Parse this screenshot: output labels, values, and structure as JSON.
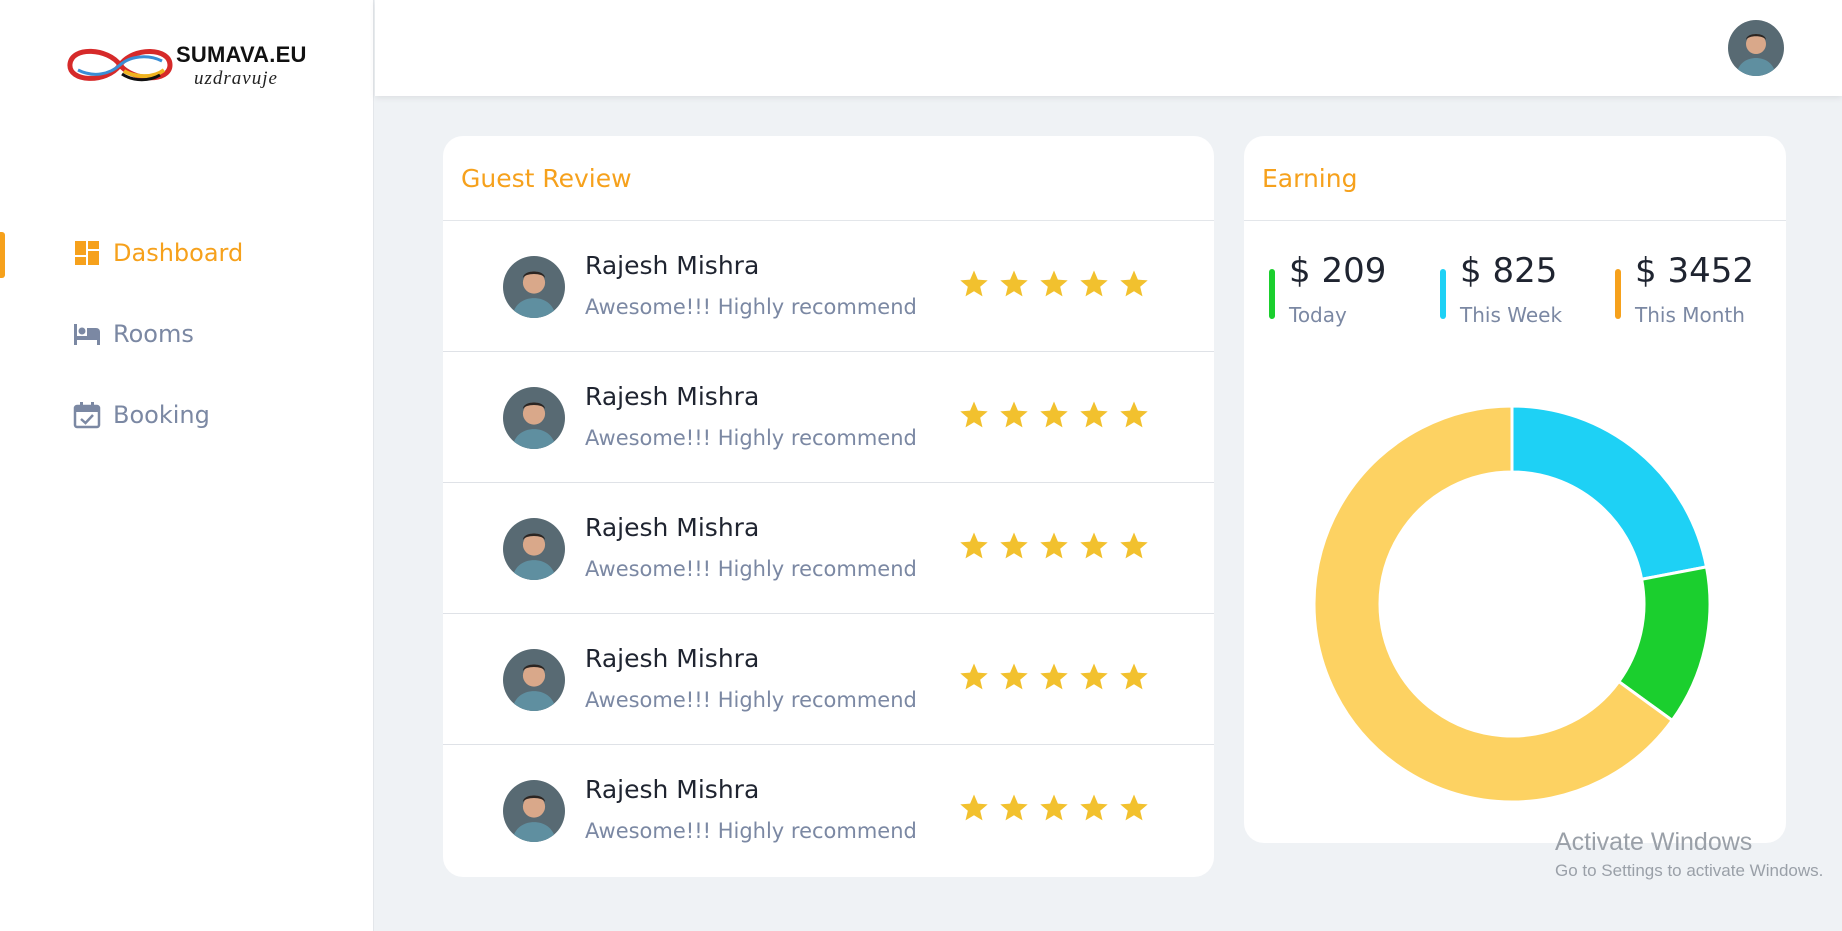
{
  "brand": {
    "name": "SUMAVA.EU",
    "tagline": "uzdravuje"
  },
  "sidebar": {
    "items": [
      {
        "label": "Dashboard",
        "icon": "dashboard-icon",
        "active": true
      },
      {
        "label": "Rooms",
        "icon": "bed-icon",
        "active": false
      },
      {
        "label": "Booking",
        "icon": "calendar-check-icon",
        "active": false
      }
    ]
  },
  "reviews": {
    "title": "Guest Review",
    "items": [
      {
        "name": "Rajesh Mishra",
        "text": "Awesome!!! Highly recommend",
        "rating": 5
      },
      {
        "name": "Rajesh Mishra",
        "text": "Awesome!!! Highly recommend",
        "rating": 5
      },
      {
        "name": "Rajesh Mishra",
        "text": "Awesome!!! Highly recommend",
        "rating": 5
      },
      {
        "name": "Rajesh Mishra",
        "text": "Awesome!!! Highly recommend",
        "rating": 5
      },
      {
        "name": "Rajesh Mishra",
        "text": "Awesome!!! Highly recommend",
        "rating": 5
      }
    ]
  },
  "earning": {
    "title": "Earning",
    "stats": [
      {
        "value": "$ 209",
        "label": "Today",
        "color": "#1bcf2e"
      },
      {
        "value": "$ 825",
        "label": "This Week",
        "color": "#1ed1f5"
      },
      {
        "value": "$ 3452",
        "label": "This Month",
        "color": "#f6a11c"
      }
    ]
  },
  "chart_data": {
    "type": "pie",
    "categories": [
      "This Week",
      "Today",
      "This Month"
    ],
    "values": [
      22,
      13,
      65
    ],
    "colors": [
      "#1ed1f5",
      "#1bcf2e",
      "#fdd262"
    ],
    "title": "",
    "donut": true
  },
  "watermark": {
    "title": "Activate Windows",
    "subtitle": "Go to Settings to activate Windows."
  },
  "colors": {
    "accent": "#f6a11c",
    "star": "#f2c12e",
    "muted": "#7b88a3",
    "background": "#eff2f5"
  }
}
